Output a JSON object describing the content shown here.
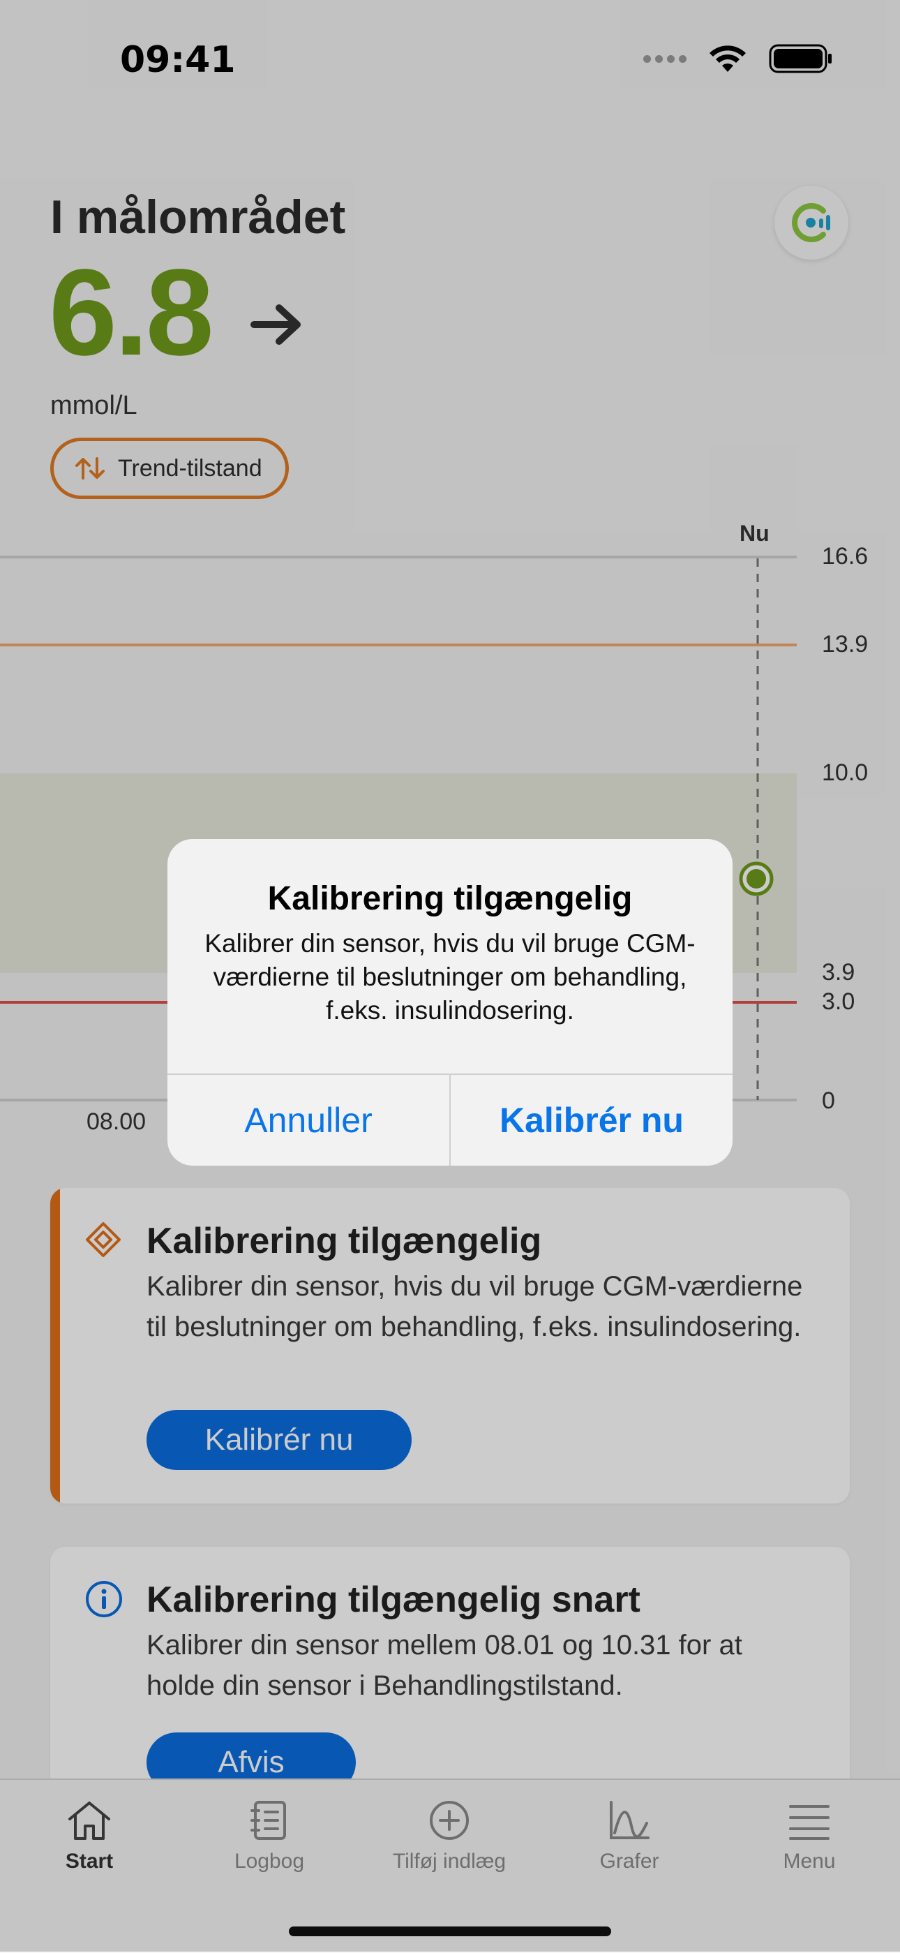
{
  "status_bar": {
    "time": "09:41"
  },
  "header": {
    "range_title": "I målområdet",
    "reading": "6.8",
    "unit": "mmol/L",
    "trend_chip": "Trend-tilstand"
  },
  "chart": {
    "now_label": "Nu",
    "y_ticks": [
      "16.6",
      "13.9",
      "10.0",
      "3.9",
      "3.0",
      "0"
    ],
    "x_ticks": [
      "08.00"
    ]
  },
  "cards": [
    {
      "title": "Kalibrering tilgængelig",
      "body": "Kalibrer din sensor, hvis du vil bruge CGM-værdierne til beslutninger om behandling, f.eks. insulindosering.",
      "button": "Kalibrér nu"
    },
    {
      "title": "Kalibrering tilgængelig snart",
      "body": "Kalibrer din sensor mellem 08.01 og 10.31 for at holde din sensor i Behandlingstilstand.",
      "button": "Afvis"
    }
  ],
  "tabbar": {
    "items": [
      {
        "label": "Start",
        "icon": "home-icon"
      },
      {
        "label": "Logbog",
        "icon": "logbook-icon"
      },
      {
        "label": "Tilføj indlæg",
        "icon": "add-circle-icon"
      },
      {
        "label": "Grafer",
        "icon": "chart-icon"
      },
      {
        "label": "Menu",
        "icon": "menu-icon"
      }
    ]
  },
  "alert": {
    "title": "Kalibrering tilgængelig",
    "message": "Kalibrer din sensor, hvis du vil bruge CGM-værdierne til beslutninger om behandling, f.eks. insulindosering.",
    "cancel": "Annuller",
    "confirm": "Kalibrér nu"
  },
  "colors": {
    "in_range": "#6e9a1c",
    "accent_orange": "#e0701a",
    "button_blue": "#0a6ee0",
    "low_line": "#d9534f",
    "high_line": "#f0a868"
  }
}
